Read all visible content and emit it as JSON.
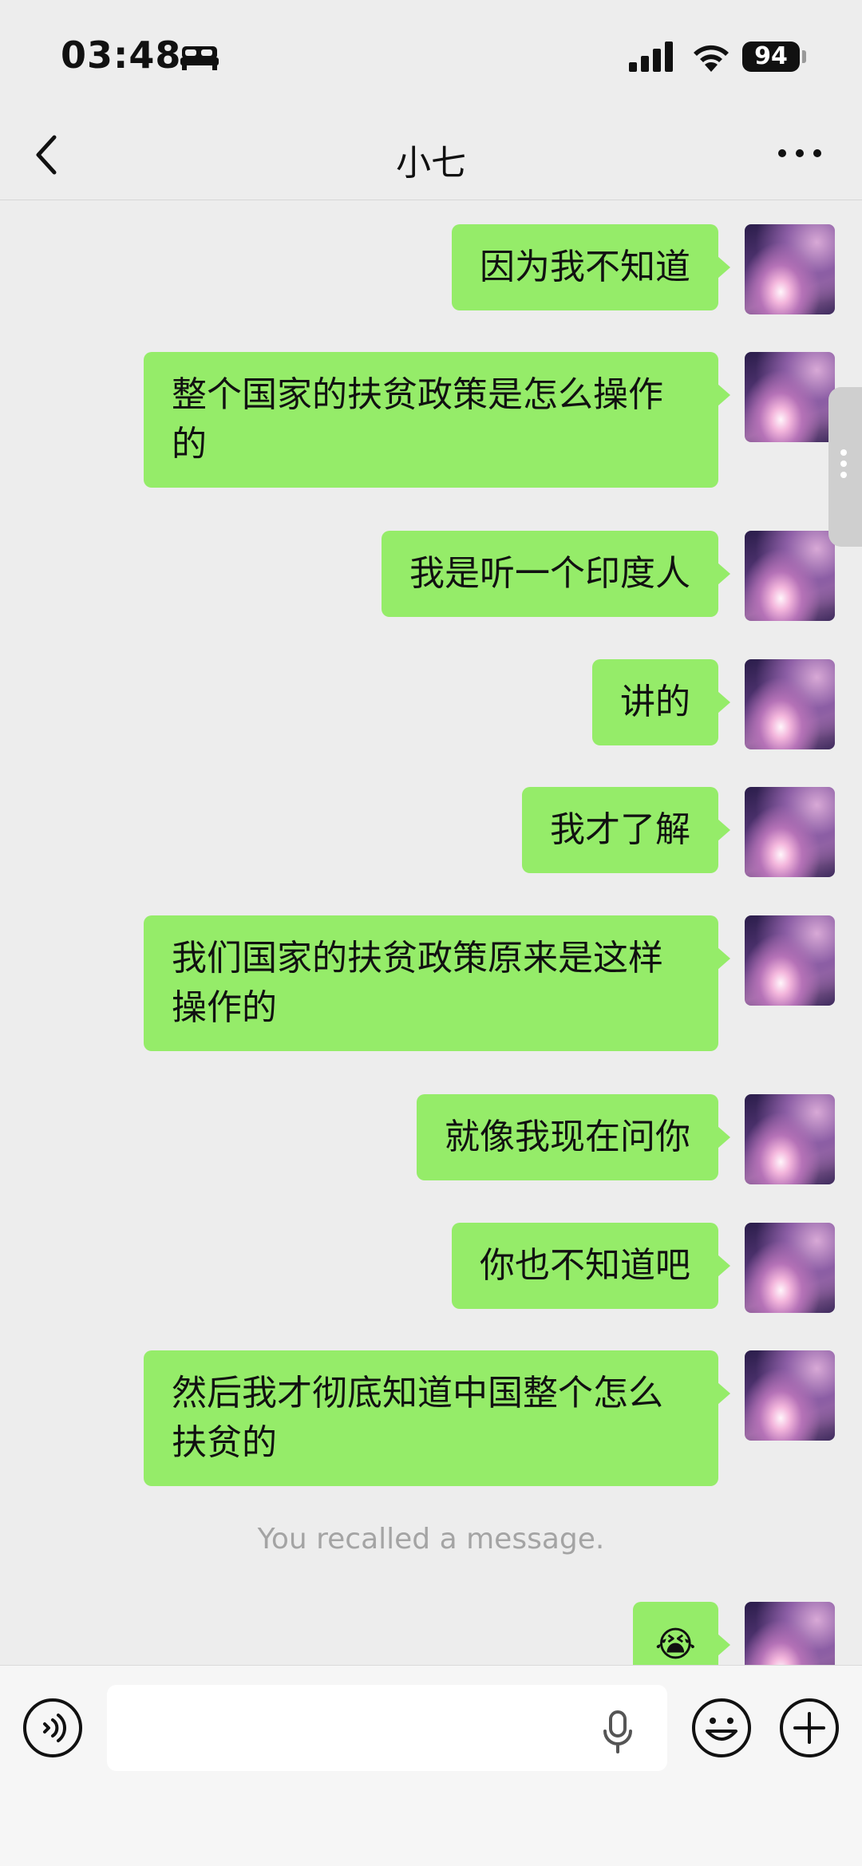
{
  "status_bar": {
    "time": "03:48",
    "battery": "94",
    "icons": [
      "bed-icon",
      "signal-icon",
      "wifi-icon",
      "battery-icon"
    ]
  },
  "navbar": {
    "title": "小七",
    "icons": [
      "back-icon",
      "more-icon"
    ]
  },
  "messages": [
    {
      "text": "因为我不知道"
    },
    {
      "text": "整个国家的扶贫政策是怎么操作的"
    },
    {
      "text": "我是听一个印度人"
    },
    {
      "text": "讲的"
    },
    {
      "text": "我才了解"
    },
    {
      "text": "我们国家的扶贫政策原来是这样操作的"
    },
    {
      "text": "就像我现在问你"
    },
    {
      "text": "你也不知道吧"
    },
    {
      "text": "然后我才彻底知道中国整个怎么扶贫的"
    }
  ],
  "recall_notice": "You recalled a message.",
  "last_message_emoji": "😭",
  "input_bar": {
    "value": "",
    "placeholder": "",
    "icons": [
      "voice-icon",
      "mic-icon",
      "emoji-icon",
      "plus-icon"
    ]
  },
  "colors": {
    "bubble": "#95EC69",
    "background": "#EDEDED",
    "recall_text": "#A4A4A4"
  }
}
